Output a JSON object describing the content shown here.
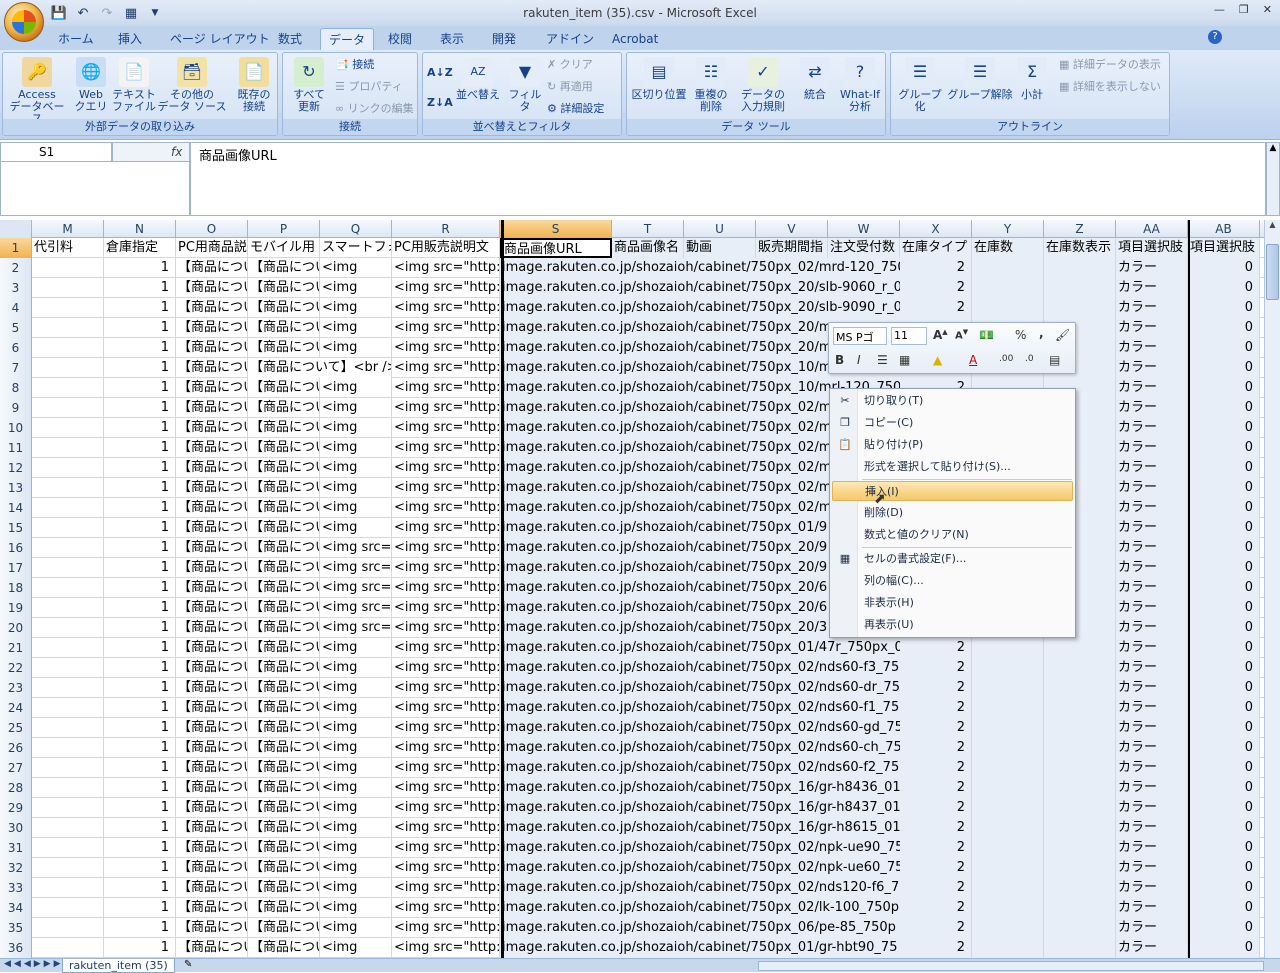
{
  "window": {
    "title": "rakuten_item (35).csv - Microsoft Excel"
  },
  "ribbon_tabs": [
    "ホーム",
    "挿入",
    "ページ レイアウト",
    "数式",
    "データ",
    "校閲",
    "表示",
    "開発",
    "アドイン",
    "Acrobat"
  ],
  "active_tab": "データ",
  "ribbon": {
    "external": {
      "access": "Access\nデータベース",
      "web": "Web\nクエリ",
      "text": "テキスト\nファイル",
      "other": "その他の\nデータ ソース",
      "existing": "既存の\n接続",
      "label": "外部データの取り込み"
    },
    "connections": {
      "refresh": "すべて\n更新",
      "connections": "接続",
      "properties": "プロパティ",
      "edit_links": "リンクの編集",
      "label": "接続"
    },
    "sort": {
      "sort": "並べ替え",
      "filter": "フィルタ",
      "clear": "クリア",
      "reapply": "再適用",
      "advanced": "詳細設定",
      "label": "並べ替えとフィルタ"
    },
    "tools": {
      "text_to_columns": "区切り位置",
      "remove_dupes": "重複の\n削除",
      "validation": "データの\n入力規則",
      "consolidate": "統合",
      "whatif": "What-If\n分析",
      "label": "データ ツール"
    },
    "outline": {
      "group": "グループ化",
      "ungroup": "グループ解除",
      "subtotal": "小計",
      "show_detail": "詳細データの表示",
      "hide_detail": "詳細を表示しない",
      "label": "アウトライン"
    }
  },
  "namebox": "S1",
  "fx_label": "fx",
  "formula": "商品画像URL",
  "columns": [
    "M",
    "N",
    "O",
    "P",
    "Q",
    "R",
    "S",
    "T",
    "U",
    "V",
    "W",
    "X",
    "Y",
    "Z",
    "AA",
    "AB"
  ],
  "header_row": [
    "代引料",
    "倉庫指定",
    "PC用商品説",
    "モバイル用",
    "スマートフォ",
    "PC用販売説明文",
    "商品画像URL",
    "商品画像名",
    "動画",
    "販売期間指",
    "注文受付数",
    "在庫タイプ",
    "在庫数",
    "在庫数表示",
    "項目選択肢",
    "項目選択肢"
  ],
  "rows": [
    {
      "n": "2",
      "o": "【商品につい",
      "p": "【商品につい",
      "q": "<img",
      "r": "<img src=\"http://",
      "url": "image.rakuten.co.jp/shozaioh/cabinet/750px_02/mrd-120_750",
      "x": "2",
      "aa": "カラー",
      "ab": "0"
    },
    {
      "n": "3",
      "o": "【商品につい",
      "p": "【商品につい",
      "q": "<img",
      "r": "<img src=\"http://",
      "url": "image.rakuten.co.jp/shozaioh/cabinet/750px_20/slb-9060_r_0",
      "x": "2",
      "aa": "カラー",
      "ab": "0"
    },
    {
      "n": "4",
      "o": "【商品につい",
      "p": "【商品につい",
      "q": "<img",
      "r": "<img src=\"http://",
      "url": "image.rakuten.co.jp/shozaioh/cabinet/750px_20/slb-9090_r_0",
      "x": "2",
      "aa": "カラー",
      "ab": "0"
    },
    {
      "n": "5",
      "o": "【商品につい",
      "p": "【商品につい",
      "q": "<img",
      "r": "<img src=\"http://",
      "url": "image.rakuten.co.jp/shozaioh/cabinet/750px_20/m",
      "x": "",
      "aa": "カラー",
      "ab": "0"
    },
    {
      "n": "6",
      "o": "【商品につい",
      "p": "【商品につい",
      "q": "<img",
      "r": "<img src=\"http://",
      "url": "image.rakuten.co.jp/shozaioh/cabinet/750px_20/m",
      "x": "",
      "aa": "カラー",
      "ab": "0"
    },
    {
      "n": "7",
      "o": "【商品につい",
      "p": "【商品について】<br />",
      "q": "",
      "r": "<img src=\"http://",
      "url": "image.rakuten.co.jp/shozaioh/cabinet/750px_10/m",
      "x": "",
      "aa": "カラー",
      "ab": "0"
    },
    {
      "n": "8",
      "o": "【商品につい",
      "p": "【商品につい",
      "q": "<img",
      "r": "<img src=\"http://",
      "url": "image.rakuten.co.jp/shozaioh/cabinet/750px_10/mrl-120_750",
      "x": "2",
      "aa": "カラー",
      "ab": "0"
    },
    {
      "n": "9",
      "o": "【商品につい",
      "p": "【商品につい",
      "q": "<img",
      "r": "<img src=\"http://",
      "url": "image.rakuten.co.jp/shozaioh/cabinet/750px_02/m",
      "x": "",
      "aa": "カラー",
      "ab": "0"
    },
    {
      "n": "10",
      "o": "【商品につい",
      "p": "【商品につい",
      "q": "<img",
      "r": "<img src=\"http://",
      "url": "image.rakuten.co.jp/shozaioh/cabinet/750px_02/m",
      "x": "",
      "aa": "カラー",
      "ab": "0"
    },
    {
      "n": "11",
      "o": "【商品につい",
      "p": "【商品につい",
      "q": "<img",
      "r": "<img src=\"http://",
      "url": "image.rakuten.co.jp/shozaioh/cabinet/750px_02/m",
      "x": "",
      "aa": "カラー",
      "ab": "0"
    },
    {
      "n": "12",
      "o": "【商品につい",
      "p": "【商品につい",
      "q": "<img",
      "r": "<img src=\"http://",
      "url": "image.rakuten.co.jp/shozaioh/cabinet/750px_02/m",
      "x": "",
      "aa": "カラー",
      "ab": "0"
    },
    {
      "n": "13",
      "o": "【商品につい",
      "p": "【商品につい",
      "q": "<img",
      "r": "<img src=\"http://",
      "url": "image.rakuten.co.jp/shozaioh/cabinet/750px_02/m",
      "x": "",
      "aa": "カラー",
      "ab": "0"
    },
    {
      "n": "14",
      "o": "【商品につい",
      "p": "【商品につい",
      "q": "<img",
      "r": "<img src=\"http://",
      "url": "image.rakuten.co.jp/shozaioh/cabinet/750px_02/m",
      "x": "",
      "aa": "カラー",
      "ab": "0"
    },
    {
      "n": "15",
      "o": "【商品につい",
      "p": "【商品につい",
      "q": "<img",
      "r": "<img src=\"http://",
      "url": "image.rakuten.co.jp/shozaioh/cabinet/750px_01/9",
      "x": "",
      "aa": "カラー",
      "ab": "0"
    },
    {
      "n": "16",
      "o": "【商品につい",
      "p": "【商品につい",
      "q": "<img src=\"",
      "r": "<img src=\"http://",
      "url": "image.rakuten.co.jp/shozaioh/cabinet/750px_20/9",
      "x": "",
      "aa": "カラー",
      "ab": "0"
    },
    {
      "n": "17",
      "o": "【商品につい",
      "p": "【商品につい",
      "q": "<img src=\"",
      "r": "<img src=\"http://",
      "url": "image.rakuten.co.jp/shozaioh/cabinet/750px_20/9",
      "x": "",
      "aa": "カラー",
      "ab": "0"
    },
    {
      "n": "18",
      "o": "【商品につい",
      "p": "【商品につい",
      "q": "<img src=\"",
      "r": "<img src=\"http://",
      "url": "image.rakuten.co.jp/shozaioh/cabinet/750px_20/6",
      "x": "",
      "aa": "カラー",
      "ab": "0"
    },
    {
      "n": "19",
      "o": "【商品につい",
      "p": "【商品につい",
      "q": "<img src=\"",
      "r": "<img src=\"http://",
      "url": "image.rakuten.co.jp/shozaioh/cabinet/750px_20/6",
      "x": "",
      "aa": "カラー",
      "ab": "0"
    },
    {
      "n": "20",
      "o": "【商品につい",
      "p": "【商品につい",
      "q": "<img src=\"",
      "r": "<img src=\"http://",
      "url": "image.rakuten.co.jp/shozaioh/cabinet/750px_20/3",
      "x": "",
      "aa": "カラー",
      "ab": "0"
    },
    {
      "n": "21",
      "o": "【商品につい",
      "p": "【商品につい",
      "q": "<img",
      "r": "<img src=\"http://",
      "url": "image.rakuten.co.jp/shozaioh/cabinet/750px_01/47r_750px_0",
      "x": "2",
      "aa": "カラー",
      "ab": "0"
    },
    {
      "n": "22",
      "o": "【商品につい",
      "p": "【商品につい",
      "q": "<img",
      "r": "<img src=\"http://",
      "url": "image.rakuten.co.jp/shozaioh/cabinet/750px_02/nds60-f3_75",
      "x": "2",
      "aa": "カラー",
      "ab": "0"
    },
    {
      "n": "23",
      "o": "【商品につい",
      "p": "【商品につい",
      "q": "<img",
      "r": "<img src=\"http://",
      "url": "image.rakuten.co.jp/shozaioh/cabinet/750px_02/nds60-dr_75",
      "x": "2",
      "aa": "カラー",
      "ab": "0"
    },
    {
      "n": "24",
      "o": "【商品につい",
      "p": "【商品につい",
      "q": "<img",
      "r": "<img src=\"http://",
      "url": "image.rakuten.co.jp/shozaioh/cabinet/750px_02/nds60-f1_75",
      "x": "2",
      "aa": "カラー",
      "ab": "0"
    },
    {
      "n": "25",
      "o": "【商品につい",
      "p": "【商品につい",
      "q": "<img",
      "r": "<img src=\"http://",
      "url": "image.rakuten.co.jp/shozaioh/cabinet/750px_02/nds60-gd_75",
      "x": "2",
      "aa": "カラー",
      "ab": "0"
    },
    {
      "n": "26",
      "o": "【商品につい",
      "p": "【商品につい",
      "q": "<img",
      "r": "<img src=\"http://",
      "url": "image.rakuten.co.jp/shozaioh/cabinet/750px_02/nds60-ch_75",
      "x": "2",
      "aa": "カラー",
      "ab": "0"
    },
    {
      "n": "27",
      "o": "【商品につい",
      "p": "【商品につい",
      "q": "<img",
      "r": "<img src=\"http://",
      "url": "image.rakuten.co.jp/shozaioh/cabinet/750px_02/nds60-f2_75",
      "x": "2",
      "aa": "カラー",
      "ab": "0"
    },
    {
      "n": "28",
      "o": "【商品につい",
      "p": "【商品につい",
      "q": "<img",
      "r": "<img src=\"http://",
      "url": "image.rakuten.co.jp/shozaioh/cabinet/750px_16/gr-h8436_01",
      "x": "2",
      "aa": "カラー",
      "ab": "0"
    },
    {
      "n": "29",
      "o": "【商品につい",
      "p": "【商品につい",
      "q": "<img",
      "r": "<img src=\"http://",
      "url": "image.rakuten.co.jp/shozaioh/cabinet/750px_16/gr-h8437_01",
      "x": "2",
      "aa": "カラー",
      "ab": "0"
    },
    {
      "n": "30",
      "o": "【商品につい",
      "p": "【商品につい",
      "q": "<img",
      "r": "<img src=\"http://",
      "url": "image.rakuten.co.jp/shozaioh/cabinet/750px_16/gr-h8615_01",
      "x": "2",
      "aa": "カラー",
      "ab": "0"
    },
    {
      "n": "31",
      "o": "【商品につい",
      "p": "【商品につい",
      "q": "<img",
      "r": "<img src=\"http://",
      "url": "image.rakuten.co.jp/shozaioh/cabinet/750px_02/npk-ue90_75",
      "x": "2",
      "aa": "カラー",
      "ab": "0"
    },
    {
      "n": "32",
      "o": "【商品につい",
      "p": "【商品につい",
      "q": "<img",
      "r": "<img src=\"http://",
      "url": "image.rakuten.co.jp/shozaioh/cabinet/750px_02/npk-ue60_75",
      "x": "2",
      "aa": "カラー",
      "ab": "0"
    },
    {
      "n": "33",
      "o": "【商品につい",
      "p": "【商品につい",
      "q": "<img",
      "r": "<img src=\"http://",
      "url": "image.rakuten.co.jp/shozaioh/cabinet/750px_02/nds120-f6_7",
      "x": "2",
      "aa": "カラー",
      "ab": "0"
    },
    {
      "n": "34",
      "o": "【商品につい",
      "p": "【商品につい",
      "q": "<img",
      "r": "<img src=\"http://",
      "url": "image.rakuten.co.jp/shozaioh/cabinet/750px_02/lk-100_750p",
      "x": "2",
      "aa": "カラー",
      "ab": "0"
    },
    {
      "n": "35",
      "o": "【商品につい",
      "p": "【商品につい",
      "q": "<img",
      "r": "<img src=\"http://",
      "url": "image.rakuten.co.jp/shozaioh/cabinet/750px_06/pe-85_750p",
      "x": "2",
      "aa": "カラー",
      "ab": "0"
    },
    {
      "n": "36",
      "o": "【商品につい",
      "p": "【商品につい",
      "q": "<img",
      "r": "<img src=\"http://",
      "url": "image.rakuten.co.jp/shozaioh/cabinet/750px_01/gr-hbt90_75",
      "x": "2",
      "aa": "カラー",
      "ab": "0"
    }
  ],
  "n_value": "1",
  "minitoolbar": {
    "font": "MS Pゴ",
    "size": "11"
  },
  "context_menu": [
    "切り取り(T)",
    "コピー(C)",
    "貼り付け(P)",
    "形式を選択して貼り付け(S)...",
    "挿入(I)",
    "削除(D)",
    "数式と値のクリア(N)",
    "セルの書式設定(F)...",
    "列の幅(C)...",
    "非表示(H)",
    "再表示(U)"
  ],
  "sheet_tab": "rakuten_item (35)"
}
